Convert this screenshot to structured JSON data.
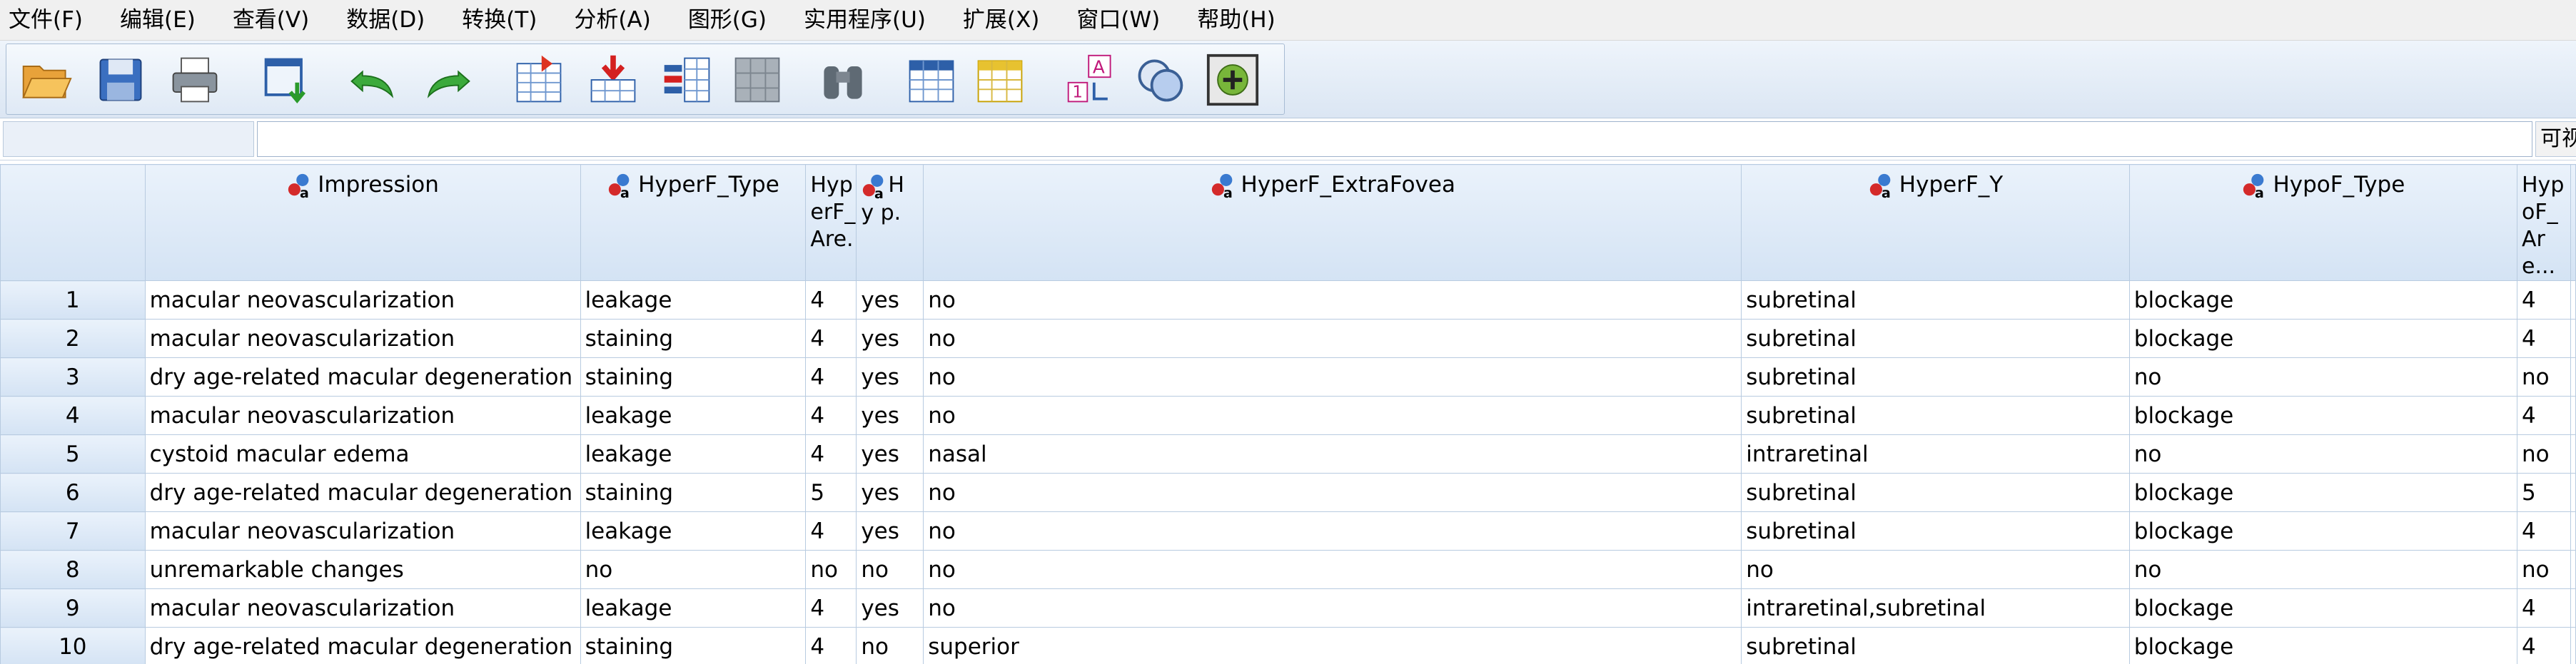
{
  "menu": [
    "文件(F)",
    "编辑(E)",
    "查看(V)",
    "数据(D)",
    "转换(T)",
    "分析(A)",
    "图形(G)",
    "实用程序(U)",
    "扩展(X)",
    "窗口(W)",
    "帮助(H)"
  ],
  "toolbar": {
    "icons": [
      "open-folder-icon",
      "save-icon",
      "print-icon",
      "recall-dialog-icon",
      "undo-icon",
      "redo-icon",
      "go-to-case-icon",
      "insert-cases-icon",
      "insert-variable-icon",
      "split-file-icon",
      "find-binoculars-icon",
      "weight-cases-icon",
      "select-cases-icon",
      "value-labels-icon",
      "use-sets-icon",
      "spell-check-icon"
    ]
  },
  "cell_editor": {
    "cell_ref": "",
    "value": "",
    "visible_label": "可视"
  },
  "grid": {
    "columns": [
      {
        "label": "Impression",
        "measure": "nominal"
      },
      {
        "label": "HyperF_Type",
        "measure": "nominal"
      },
      {
        "label": "HyperF_Are...",
        "measure": "scale"
      },
      {
        "label": "HyperF_Exp...",
        "measure": "nominal"
      },
      {
        "label": "HyperF_ExtraFovea",
        "measure": "nominal"
      },
      {
        "label": "HyperF_Y",
        "measure": "nominal"
      },
      {
        "label": "HypoF_Type",
        "measure": "nominal"
      },
      {
        "label": "HypoF_Are...",
        "measure": "scale"
      }
    ],
    "narrow_headers": {
      "c2": "Hyp erF_ Are.",
      "c3": "H y p."
    },
    "rows": [
      {
        "n": "1",
        "cells": [
          "macular neovascularization",
          "leakage",
          "4",
          "yes",
          "no",
          "subretinal",
          "blockage",
          "4"
        ]
      },
      {
        "n": "2",
        "cells": [
          "macular neovascularization",
          "staining",
          "4",
          "yes",
          "no",
          "subretinal",
          "blockage",
          "4"
        ]
      },
      {
        "n": "3",
        "cells": [
          "dry age-related macular degeneration",
          "staining",
          "4",
          "yes",
          "no",
          "subretinal",
          "no",
          "no"
        ]
      },
      {
        "n": "4",
        "cells": [
          "macular neovascularization",
          "leakage",
          "4",
          "yes",
          "no",
          "subretinal",
          "blockage",
          "4"
        ]
      },
      {
        "n": "5",
        "cells": [
          "cystoid macular edema",
          "leakage",
          "4",
          "yes",
          "nasal",
          "intraretinal",
          "no",
          "no"
        ]
      },
      {
        "n": "6",
        "cells": [
          "dry age-related macular degeneration",
          "staining",
          "5",
          "yes",
          "no",
          "subretinal",
          "blockage",
          "5"
        ]
      },
      {
        "n": "7",
        "cells": [
          "macular neovascularization",
          "leakage",
          "4",
          "yes",
          "no",
          "subretinal",
          "blockage",
          "4"
        ]
      },
      {
        "n": "8",
        "cells": [
          "unremarkable changes",
          "no",
          "no",
          "no",
          "no",
          "no",
          "no",
          "no"
        ]
      },
      {
        "n": "9",
        "cells": [
          "macular neovascularization",
          "leakage",
          "4",
          "yes",
          "no",
          "intraretinal,subretinal",
          "blockage",
          "4"
        ]
      },
      {
        "n": "10",
        "cells": [
          "dry age-related macular degeneration",
          "staining",
          "4",
          "no",
          "superior",
          "subretinal",
          "blockage",
          "4"
        ]
      }
    ]
  }
}
